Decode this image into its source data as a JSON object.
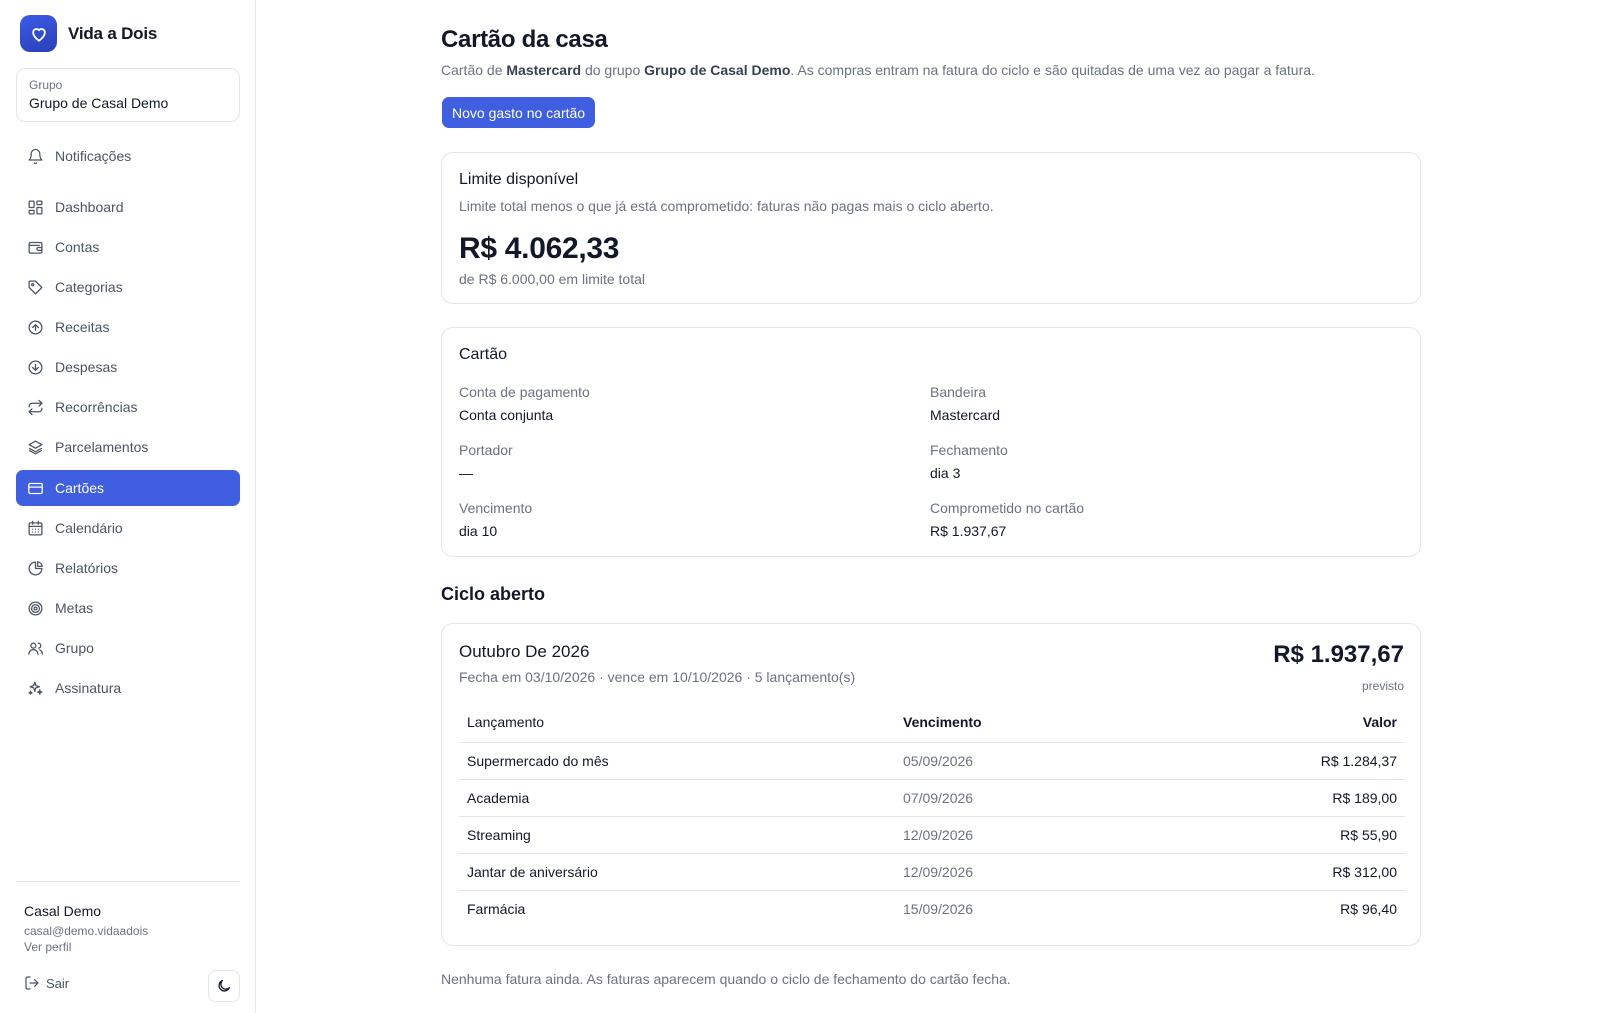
{
  "app": {
    "name": "Vida a Dois"
  },
  "group": {
    "label": "Grupo",
    "name": "Grupo de Casal Demo"
  },
  "nav": {
    "notifications": "Notificações",
    "items": [
      {
        "label": "Dashboard",
        "icon": "grid-icon"
      },
      {
        "label": "Contas",
        "icon": "wallet-icon"
      },
      {
        "label": "Categorias",
        "icon": "tag-icon"
      },
      {
        "label": "Receitas",
        "icon": "arrow-up-circle-icon"
      },
      {
        "label": "Despesas",
        "icon": "arrow-down-circle-icon"
      },
      {
        "label": "Recorrências",
        "icon": "repeat-icon"
      },
      {
        "label": "Parcelamentos",
        "icon": "layers-icon"
      },
      {
        "label": "Cartões",
        "icon": "credit-card-icon",
        "active": true
      },
      {
        "label": "Calendário",
        "icon": "calendar-icon"
      },
      {
        "label": "Relatórios",
        "icon": "pie-chart-icon"
      },
      {
        "label": "Metas",
        "icon": "target-icon"
      },
      {
        "label": "Grupo",
        "icon": "users-icon"
      },
      {
        "label": "Assinatura",
        "icon": "sparkles-icon"
      }
    ]
  },
  "user": {
    "name": "Casal Demo",
    "email": "casal@demo.vidaadois",
    "profile_link": "Ver perfil",
    "logout": "Sair"
  },
  "page": {
    "title": "Cartão da casa",
    "desc_prefix": "Cartão de ",
    "desc_brand": "Mastercard",
    "desc_middle": " do grupo ",
    "desc_group": "Grupo de Casal Demo",
    "desc_suffix": ". As compras entram na fatura do ciclo e são quitadas de uma vez ao pagar a fatura.",
    "new_expense_button": "Novo gasto no cartão"
  },
  "limit": {
    "title": "Limite disponível",
    "description": "Limite total menos o que já está comprometido: faturas não pagas mais o ciclo aberto.",
    "available": "R$ 4.062,33",
    "total_text": "de R$ 6.000,00 em limite total"
  },
  "card_info": {
    "title": "Cartão",
    "fields": {
      "payment_account": {
        "label": "Conta de pagamento",
        "value": "Conta conjunta"
      },
      "brand": {
        "label": "Bandeira",
        "value": "Mastercard"
      },
      "holder": {
        "label": "Portador",
        "value": "—"
      },
      "closing": {
        "label": "Fechamento",
        "value": "dia 3"
      },
      "due": {
        "label": "Vencimento",
        "value": "dia 10"
      },
      "committed": {
        "label": "Comprometido no cartão",
        "value": "R$ 1.937,67"
      }
    }
  },
  "open_cycle": {
    "section_title": "Ciclo aberto",
    "name": "Outubro De 2026",
    "meta": "Fecha em 03/10/2026 · vence em 10/10/2026 · 5 lançamento(s)",
    "total": "R$ 1.937,67",
    "total_label": "previsto",
    "columns": {
      "description": "Lançamento",
      "due": "Vencimento",
      "value": "Valor"
    },
    "rows": [
      {
        "description": "Supermercado do mês",
        "due": "05/09/2026",
        "value": "R$ 1.284,37"
      },
      {
        "description": "Academia",
        "due": "07/09/2026",
        "value": "R$ 189,00"
      },
      {
        "description": "Streaming",
        "due": "12/09/2026",
        "value": "R$ 55,90"
      },
      {
        "description": "Jantar de aniversário",
        "due": "12/09/2026",
        "value": "R$ 312,00"
      },
      {
        "description": "Farmácia",
        "due": "15/09/2026",
        "value": "R$ 96,40"
      }
    ]
  },
  "invoices": {
    "empty_message": "Nenhuma fatura ainda. As faturas aparecem quando o ciclo de fechamento do cartão fecha."
  },
  "colors": {
    "accent": "#3f5fe0",
    "text": "#111827",
    "muted": "#6b7280",
    "border": "#e3e5e9"
  }
}
